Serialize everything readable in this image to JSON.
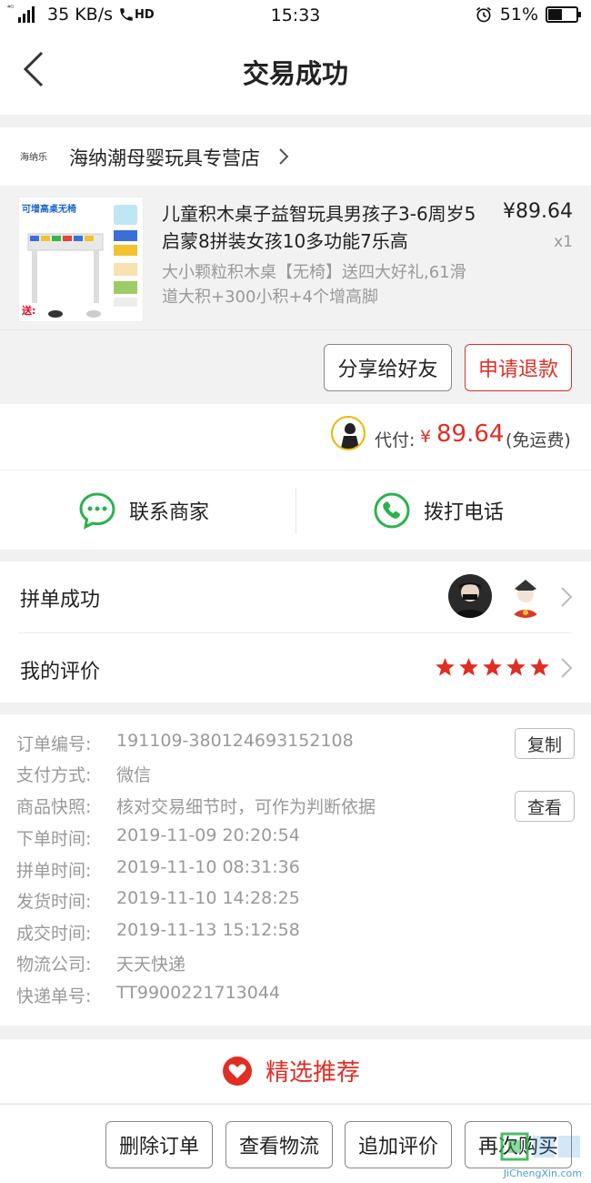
{
  "status_bar": {
    "network_tag": "⁴ᴳ",
    "speed": "35 KB/s",
    "hd": "HD",
    "time": "15:33",
    "battery": "51%",
    "battery_level": 0.51
  },
  "header": {
    "title": "交易成功"
  },
  "store": {
    "logo_text": "海纳乐",
    "name": "海纳潮母婴玩具专营店"
  },
  "product": {
    "thumb_caption": "可增高桌无椅",
    "thumb_send": "送:",
    "title": "儿童积木桌子益智玩具男孩子3-6周岁5启蒙8拼装女孩10多功能7乐高",
    "spec": "大小颗粒积木桌【无椅】送四大好礼,61滑道大积+300小积+4个增高脚",
    "price": "¥89.64",
    "qty": "x1"
  },
  "actions": {
    "share": "分享给好友",
    "refund": "申请退款"
  },
  "payment": {
    "label": "代付:",
    "currency": "¥",
    "amount": "89.64",
    "note": "(免运费)"
  },
  "contact": {
    "merchant": "联系商家",
    "call": "拨打电话"
  },
  "group": {
    "label": "拼单成功"
  },
  "review": {
    "label": "我的评价",
    "stars": 5
  },
  "order_info": {
    "rows": [
      {
        "key": "订单编号:",
        "value": "191109-380124693152108"
      },
      {
        "key": "支付方式:",
        "value": "微信"
      },
      {
        "key": "商品快照:",
        "value": "核对交易细节时，可作为判断依据"
      },
      {
        "key": "下单时间:",
        "value": "2019-11-09 20:20:54"
      },
      {
        "key": "拼单时间:",
        "value": "2019-11-10 08:31:36"
      },
      {
        "key": "发货时间:",
        "value": "2019-11-10 14:28:25"
      },
      {
        "key": "成交时间:",
        "value": "2019-11-13 15:12:58"
      },
      {
        "key": "物流公司:",
        "value": "天天快递"
      },
      {
        "key": "快递单号:",
        "value": "TT9900221713044"
      }
    ],
    "copy_label": "复制",
    "view_label": "查看"
  },
  "recommend": {
    "label": "精选推荐"
  },
  "bottom_bar": {
    "delete": "删除订单",
    "logistics": "查看物流",
    "add_review": "追加评价",
    "rebuy": "再次购买"
  },
  "watermark": {
    "text": "JiChengXin.com"
  },
  "colors": {
    "accent": "#e02e24",
    "wechat_green": "#2bb24c",
    "star": "#e02e24"
  }
}
